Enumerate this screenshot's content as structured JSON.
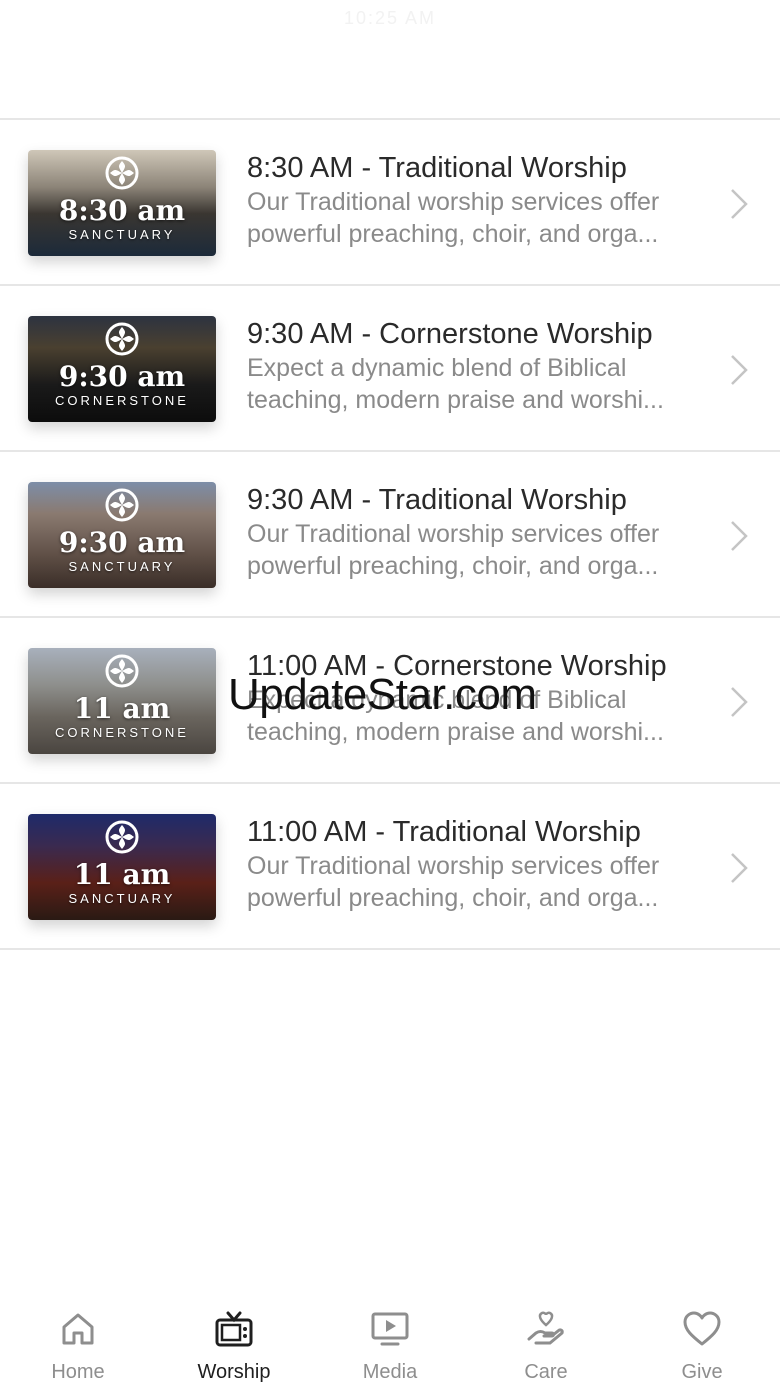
{
  "header": {
    "title": "10:25 AM"
  },
  "services": [
    {
      "title": "8:30 AM - Traditional Worship",
      "desc_line1": "Our Traditional worship services offer",
      "desc_line2": "powerful preaching, choir, and orga...",
      "thumb_time": "8:30 am",
      "thumb_venue": "SANCTUARY"
    },
    {
      "title": "9:30 AM - Cornerstone Worship",
      "desc_line1": "Expect a dynamic blend of Biblical",
      "desc_line2": "teaching, modern praise and worshi...",
      "thumb_time": "9:30 am",
      "thumb_venue": "CORNERSTONE"
    },
    {
      "title": "9:30 AM - Traditional Worship",
      "desc_line1": "Our Traditional worship services offer",
      "desc_line2": "powerful preaching, choir, and orga...",
      "thumb_time": "9:30 am",
      "thumb_venue": "SANCTUARY"
    },
    {
      "title": "11:00 AM - Cornerstone Worship",
      "desc_line1": "Expect a dynamic blend of Biblical",
      "desc_line2": "teaching, modern praise and worshi...",
      "thumb_time": "11 am",
      "thumb_venue": "CORNERSTONE"
    },
    {
      "title": "11:00 AM - Traditional Worship",
      "desc_line1": "Our Traditional worship services offer",
      "desc_line2": "powerful preaching, choir, and orga...",
      "thumb_time": "11 am",
      "thumb_venue": "SANCTUARY"
    }
  ],
  "watermark": "UpdateStar.com",
  "tabs": [
    {
      "label": "Home",
      "icon": "home-icon"
    },
    {
      "label": "Worship",
      "icon": "tv-icon",
      "active": true
    },
    {
      "label": "Media",
      "icon": "play-screen-icon"
    },
    {
      "label": "Care",
      "icon": "heart-hand-icon"
    },
    {
      "label": "Give",
      "icon": "heart-icon"
    }
  ],
  "colors": {
    "active_tab": "#1f1f1f",
    "inactive_tab": "#8e8e8e",
    "title_text": "#2a2a2a",
    "desc_text": "#8a8a8a",
    "divider": "#e6e6e6"
  }
}
